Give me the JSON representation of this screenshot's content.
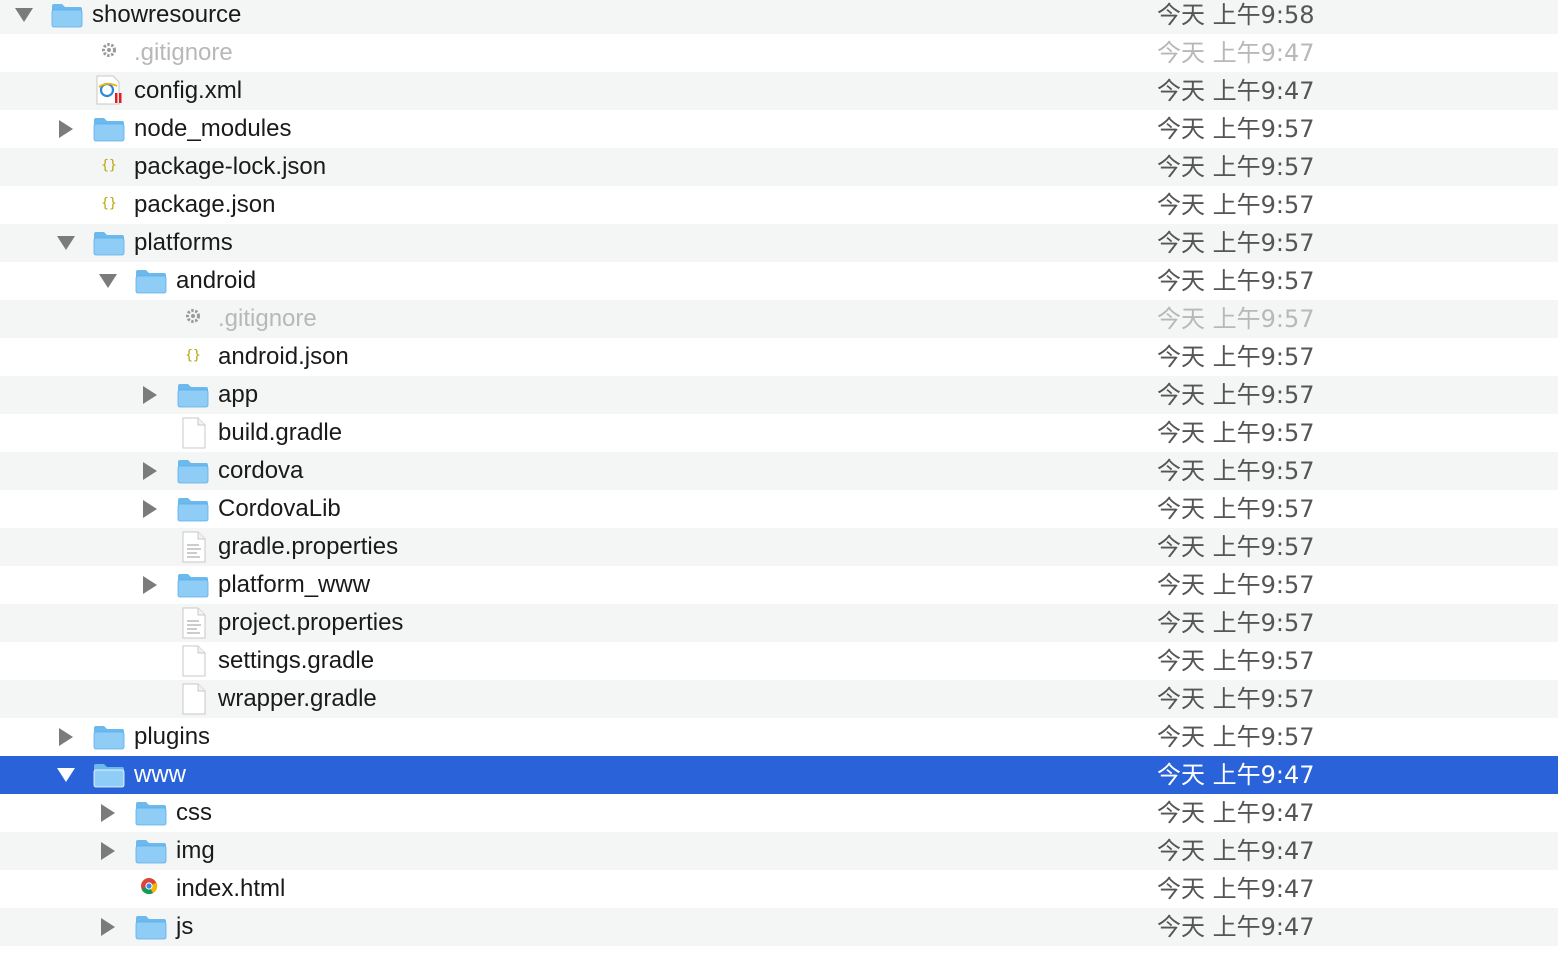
{
  "rows": [
    {
      "name": "showresource",
      "date": "今天 上午9:58",
      "depth": 0,
      "type": "folder",
      "expanded": true,
      "alt": true
    },
    {
      "name": ".gitignore",
      "date": "今天 上午9:47",
      "depth": 1,
      "type": "gear",
      "dim": true
    },
    {
      "name": "config.xml",
      "date": "今天 上午9:47",
      "depth": 1,
      "type": "xml",
      "alt": true
    },
    {
      "name": "node_modules",
      "date": "今天 上午9:57",
      "depth": 1,
      "type": "folder",
      "expanded": false
    },
    {
      "name": "package-lock.json",
      "date": "今天 上午9:57",
      "depth": 1,
      "type": "json",
      "alt": true
    },
    {
      "name": "package.json",
      "date": "今天 上午9:57",
      "depth": 1,
      "type": "json"
    },
    {
      "name": "platforms",
      "date": "今天 上午9:57",
      "depth": 1,
      "type": "folder",
      "expanded": true,
      "alt": true
    },
    {
      "name": "android",
      "date": "今天 上午9:57",
      "depth": 2,
      "type": "folder",
      "expanded": true
    },
    {
      "name": ".gitignore",
      "date": "今天 上午9:57",
      "depth": 3,
      "type": "gear",
      "dim": true,
      "alt": true
    },
    {
      "name": "android.json",
      "date": "今天 上午9:57",
      "depth": 3,
      "type": "json"
    },
    {
      "name": "app",
      "date": "今天 上午9:57",
      "depth": 3,
      "type": "folder",
      "expanded": false,
      "alt": true
    },
    {
      "name": "build.gradle",
      "date": "今天 上午9:57",
      "depth": 3,
      "type": "doc"
    },
    {
      "name": "cordova",
      "date": "今天 上午9:57",
      "depth": 3,
      "type": "folder",
      "expanded": false,
      "alt": true
    },
    {
      "name": "CordovaLib",
      "date": "今天 上午9:57",
      "depth": 3,
      "type": "folder",
      "expanded": false
    },
    {
      "name": "gradle.properties",
      "date": "今天 上午9:57",
      "depth": 3,
      "type": "text",
      "alt": true
    },
    {
      "name": "platform_www",
      "date": "今天 上午9:57",
      "depth": 3,
      "type": "folder",
      "expanded": false
    },
    {
      "name": "project.properties",
      "date": "今天 上午9:57",
      "depth": 3,
      "type": "text",
      "alt": true
    },
    {
      "name": "settings.gradle",
      "date": "今天 上午9:57",
      "depth": 3,
      "type": "doc"
    },
    {
      "name": "wrapper.gradle",
      "date": "今天 上午9:57",
      "depth": 3,
      "type": "doc",
      "alt": true
    },
    {
      "name": "plugins",
      "date": "今天 上午9:57",
      "depth": 1,
      "type": "folder",
      "expanded": false
    },
    {
      "name": "www",
      "date": "今天 上午9:47",
      "depth": 1,
      "type": "folder",
      "expanded": true,
      "selected": true
    },
    {
      "name": "css",
      "date": "今天 上午9:47",
      "depth": 2,
      "type": "folder",
      "expanded": false
    },
    {
      "name": "img",
      "date": "今天 上午9:47",
      "depth": 2,
      "type": "folder",
      "expanded": false,
      "alt": true
    },
    {
      "name": "index.html",
      "date": "今天 上午9:47",
      "depth": 2,
      "type": "html"
    },
    {
      "name": "js",
      "date": "今天 上午9:47",
      "depth": 2,
      "type": "folder",
      "expanded": false,
      "alt": true
    }
  ],
  "icons": {
    "folder": "folder-icon",
    "gear": "gear-file-icon",
    "xml": "xml-file-icon",
    "json": "json-file-icon",
    "doc": "document-icon",
    "text": "text-file-icon",
    "html": "chrome-html-icon"
  },
  "colors": {
    "selection": "#2962d9",
    "alt_row": "#f4f5f5",
    "folder_body": "#8fcdf7",
    "folder_tab": "#6cb9ee"
  }
}
